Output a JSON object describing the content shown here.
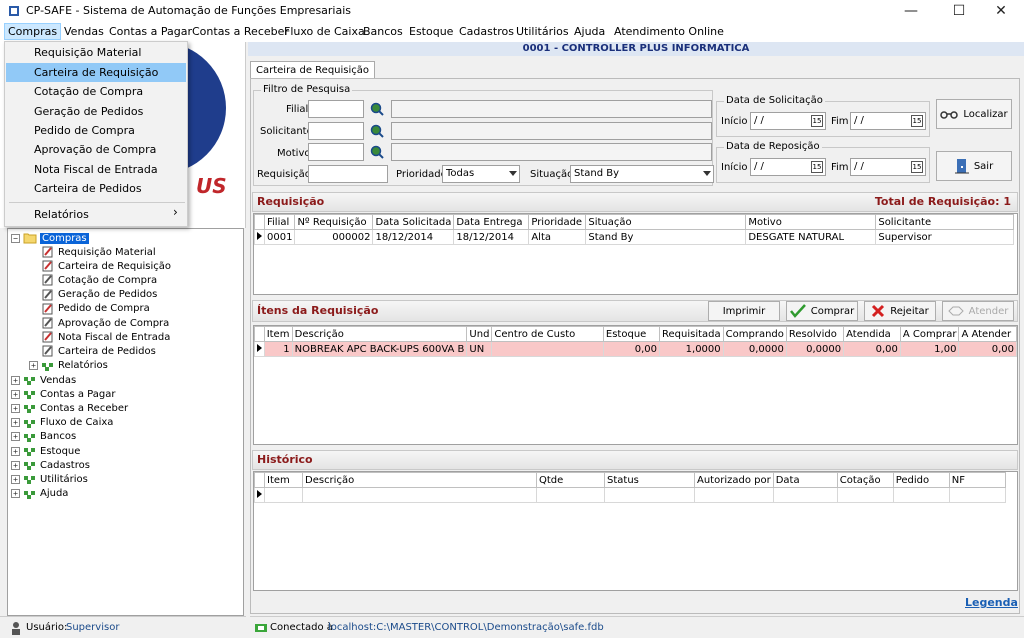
{
  "window": {
    "title": "CP-SAFE  -  Sistema de Automação de Funções Empresariais",
    "min": "—",
    "max": "☐",
    "close": "✕"
  },
  "menu": [
    {
      "label": "Compras"
    },
    {
      "label": "Vendas"
    },
    {
      "label": "Contas a Pagar"
    },
    {
      "label": "Contas a Receber"
    },
    {
      "label": "Fluxo de Caixa"
    },
    {
      "label": "Bancos"
    },
    {
      "label": "Estoque"
    },
    {
      "label": "Cadastros"
    },
    {
      "label": "Utilitários"
    },
    {
      "label": "Ajuda"
    },
    {
      "label": "Atendimento Online"
    }
  ],
  "dropdown": {
    "items": [
      "Requisição Material",
      "Carteira de Requisição",
      "Cotação de Compra",
      "Geração de Pedidos",
      "Pedido de Compra",
      "Aprovação de Compra",
      "Nota Fiscal de Entrada",
      "Carteira de Pedidos"
    ],
    "submenu": "Relatórios",
    "submenu_arrow": "›",
    "highlighted": "Carteira de Requisição"
  },
  "logo_text": "US",
  "tree": {
    "root": "Compras",
    "children": [
      "Requisição Material",
      "Carteira de Requisição",
      "Cotação de Compra",
      "Geração de Pedidos",
      "Pedido de Compra",
      "Aprovação de Compra",
      "Nota Fiscal de Entrada",
      "Carteira de Pedidos",
      "Relatórios"
    ],
    "modules": [
      "Vendas",
      "Contas a Pagar",
      "Contas a Receber",
      "Fluxo de Caixa",
      "Bancos",
      "Estoque",
      "Cadastros",
      "Utilitários",
      "Ajuda"
    ]
  },
  "company": "0001 - CONTROLLER PLUS INFORMATICA",
  "tab": "Carteira de Requisição",
  "filter": {
    "group": "Filtro de Pesquisa",
    "filial_label": "Filial",
    "solicitante_label": "Solicitante",
    "motivo_label": "Motivo",
    "requisicao_label": "Requisição",
    "prioridade_label": "Prioridade",
    "prioridade_value": "Todas",
    "situacao_label": "Situação",
    "situacao_value": "Stand By",
    "data_solic_group": "Data de Solicitação",
    "data_repos_group": "Data de Reposição",
    "inicio_label": "Início",
    "fim_label": "Fim",
    "date_empty": " / /",
    "cal_glyph": "15"
  },
  "buttons": {
    "localizar": "Localizar",
    "sair": "Sair",
    "imprimir": "Imprimir",
    "comprar": "Comprar",
    "rejeitar": "Rejeitar",
    "atender": "Atender"
  },
  "requisicao": {
    "title": "Requisição",
    "total": "Total de Requisição: 1",
    "columns": [
      "Filial",
      "Nº Requisição",
      "Data Solicitada",
      "Data Entrega",
      "Prioridade",
      "Situação",
      "Motivo",
      "Solicitante"
    ],
    "rows": [
      [
        "0001",
        "000002",
        "18/12/2014",
        "18/12/2014",
        "Alta",
        "Stand By",
        "DESGATE NATURAL",
        "Supervisor"
      ]
    ]
  },
  "itens": {
    "title": "Ítens da Requisição",
    "columns": [
      "Item",
      "Descrição",
      "Und",
      "Centro de Custo",
      "Estoque",
      "Requisitada",
      "Comprando",
      "Resolvido",
      "Atendida",
      "A Comprar",
      "A Atender"
    ],
    "rows": [
      [
        "1",
        "NOBREAK APC BACK-UPS 600VA B",
        "UN",
        "",
        "0,00",
        "1,0000",
        "0,0000",
        "0,0000",
        "0,00",
        "1,00",
        "0,00"
      ]
    ]
  },
  "historico": {
    "title": "Histórico",
    "columns": [
      "Item",
      "Descrição",
      "Qtde",
      "Status",
      "Autorizado por",
      "Data",
      "Cotação",
      "Pedido",
      "NF"
    ]
  },
  "legenda": "Legenda",
  "status": {
    "user_label": "Usuário:",
    "user": "Supervisor",
    "conn_label": "Conectado à",
    "conn": "localhost:C:\\MASTER\\CONTROL\\Demonstração\\safe.fdb"
  }
}
